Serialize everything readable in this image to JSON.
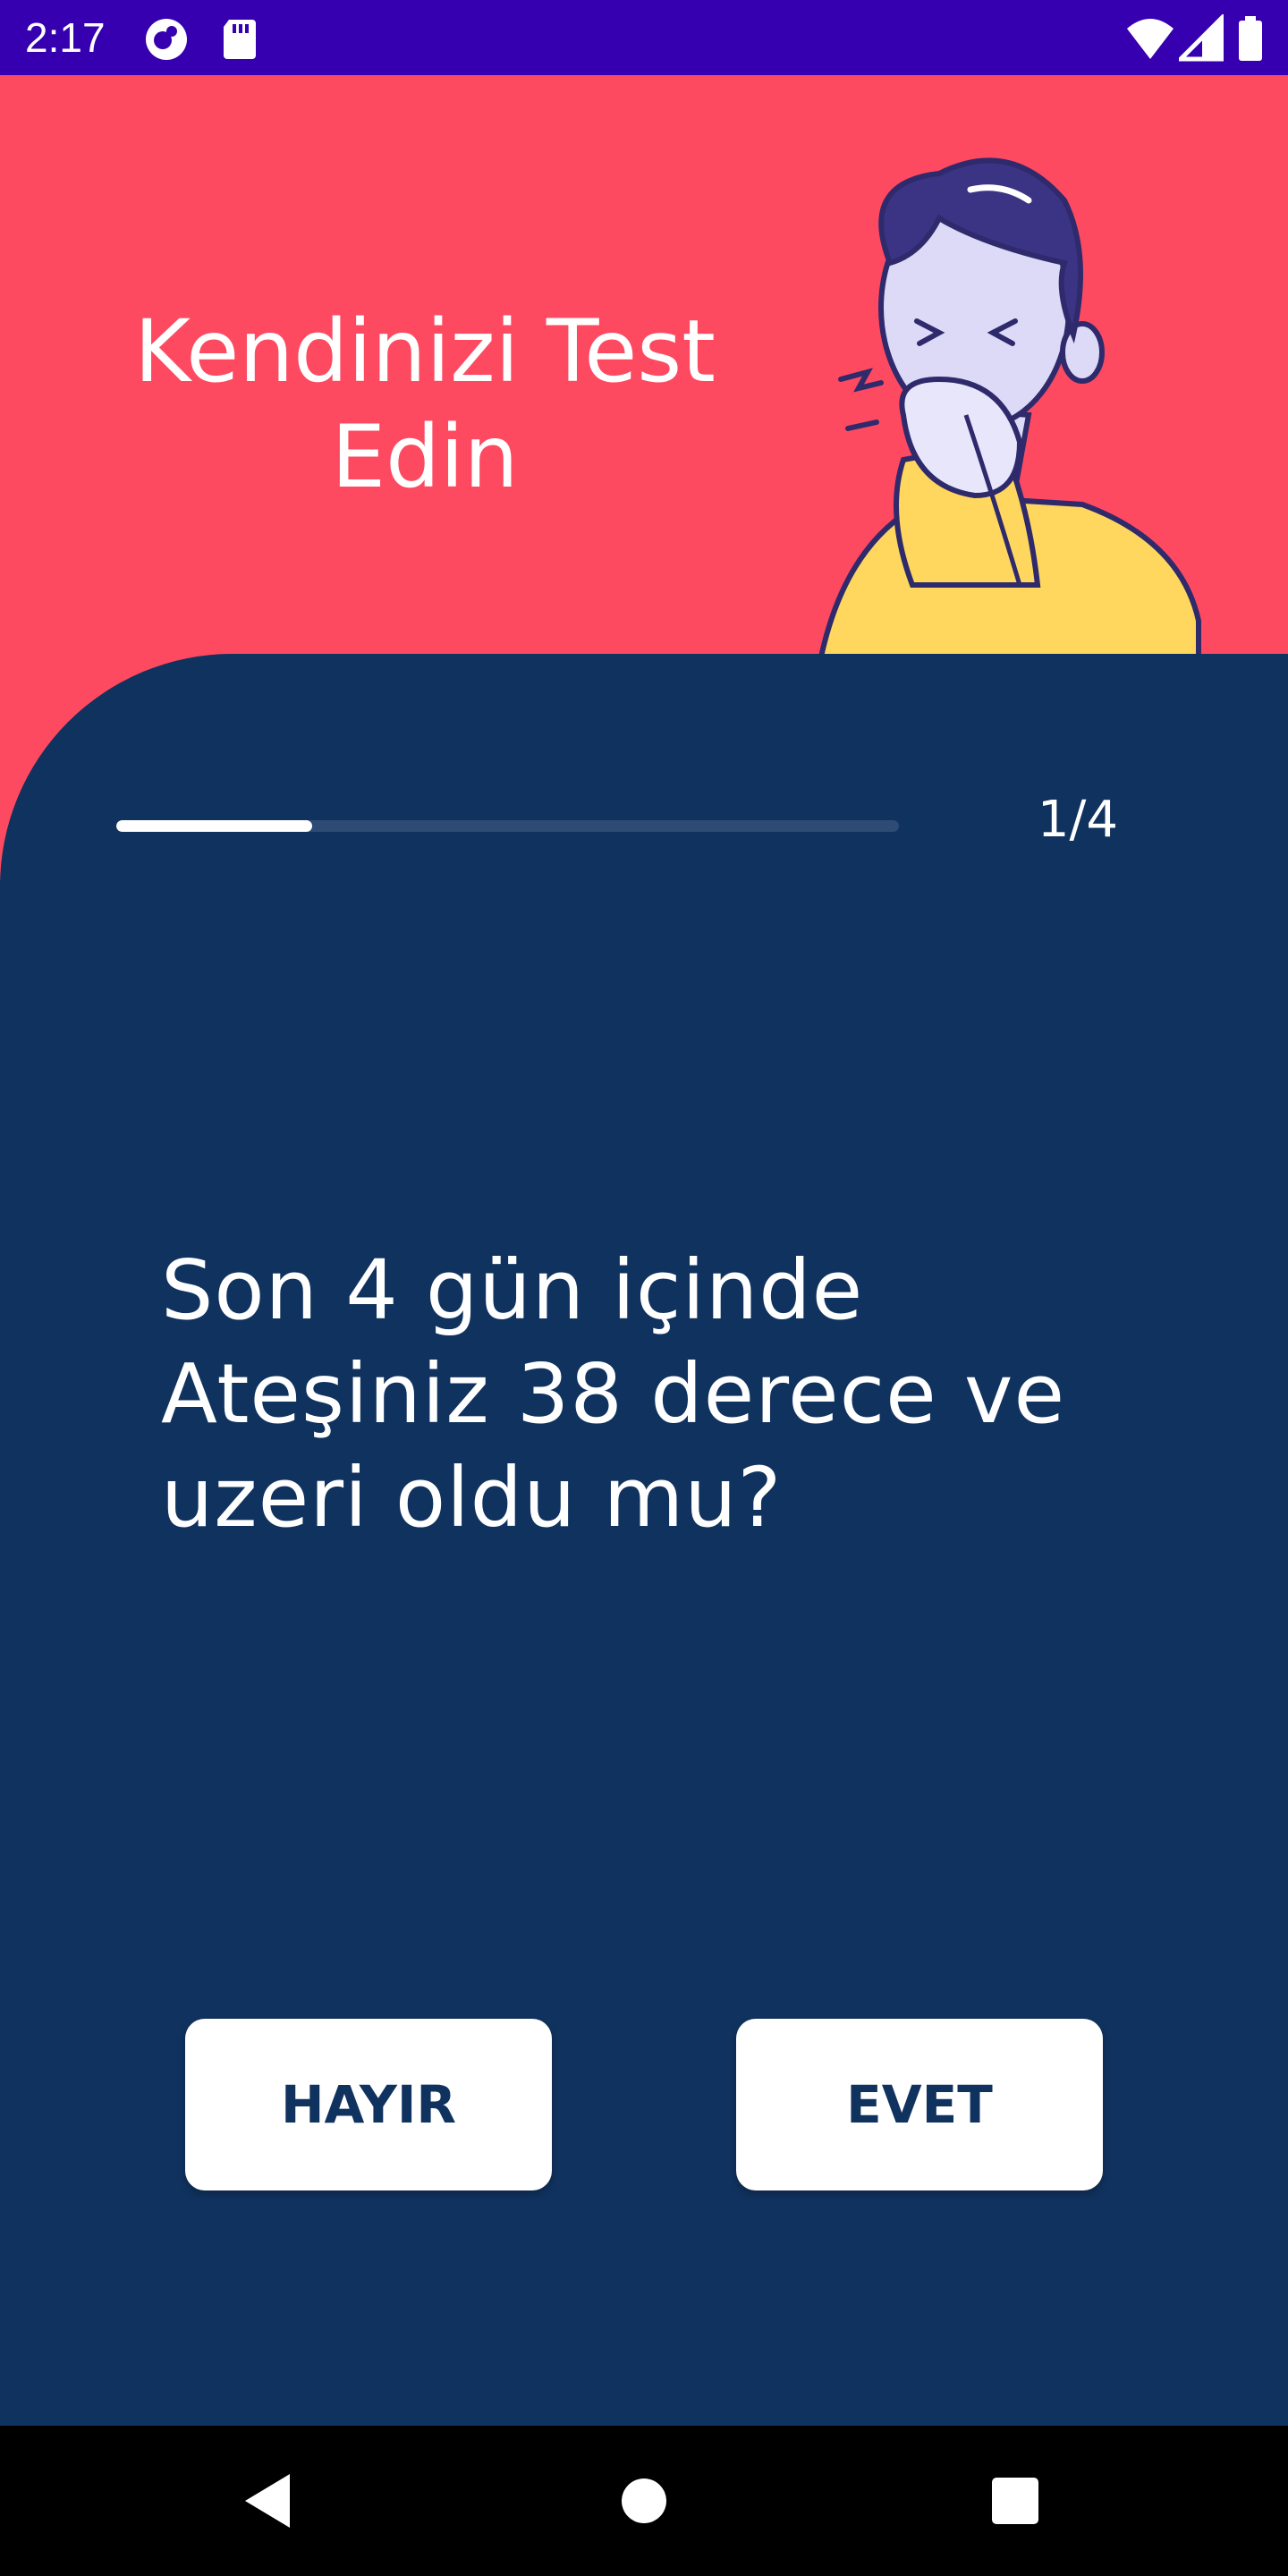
{
  "status_bar": {
    "time": "2:17",
    "left_icons": [
      "app-notification-icon",
      "sd-card-icon"
    ],
    "right_icons": [
      "wifi-icon",
      "signal-icon",
      "battery-icon"
    ]
  },
  "hero": {
    "title": "Kendinizi Test Edin",
    "illustration": "coughing-man-illustration"
  },
  "quiz": {
    "progress": 0.25,
    "step": "1/4",
    "question": "Son 4 gün içinde Ateşiniz 38 derece ve uzeri oldu mu?",
    "no_label": "HAYIR",
    "yes_label": "EVET"
  },
  "nav_bar": {
    "buttons": [
      "back-icon",
      "home-icon",
      "recents-icon"
    ]
  },
  "colors": {
    "status_bar": "#3600b0",
    "hero_bg": "#fd4a61",
    "card_bg": "#10325e",
    "button_text": "#10325e",
    "progress_track": "#2d4b75"
  }
}
